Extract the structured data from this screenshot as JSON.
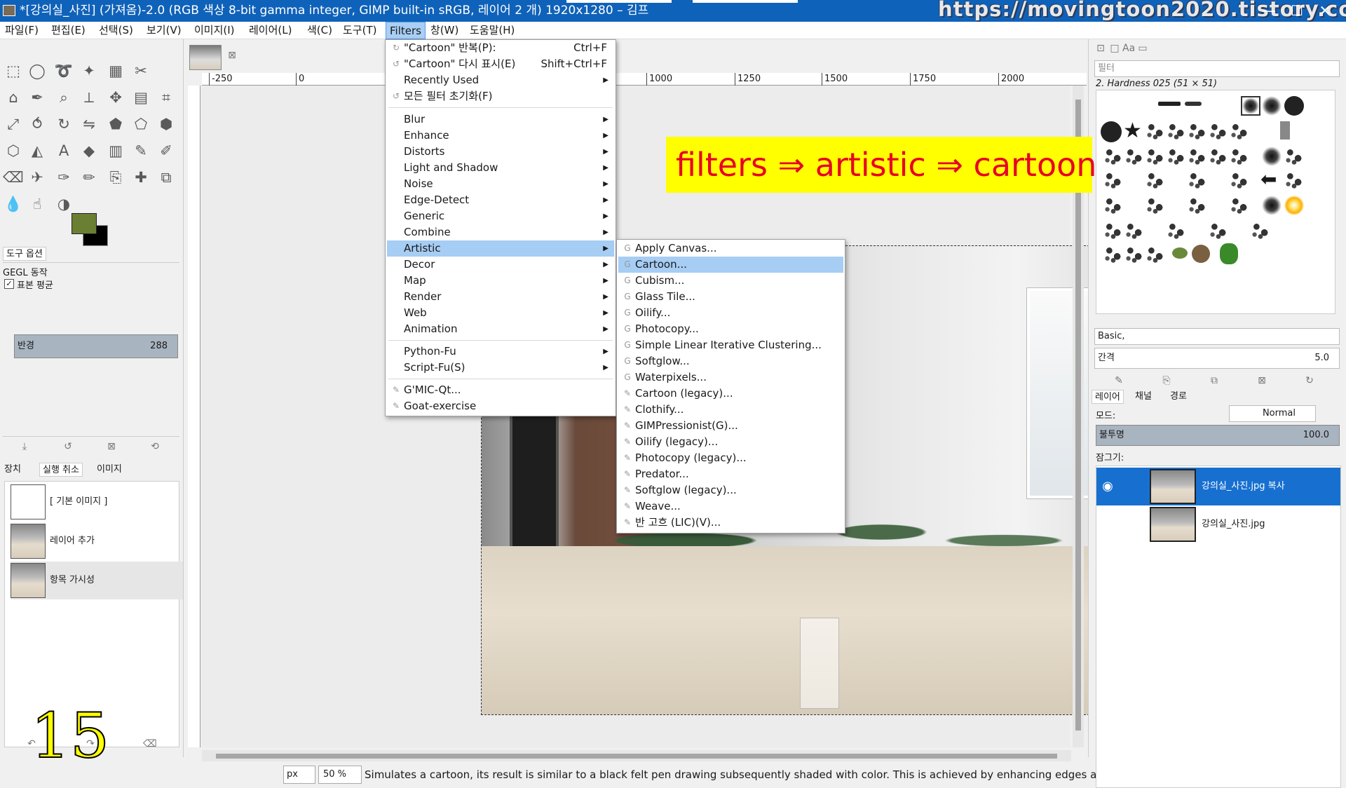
{
  "window": {
    "title": "*[강의실_사진] (가져옴)-2.0 (RGB 색상 8-bit gamma integer, GIMP built-in sRGB, 레이어 2 개) 1920x1280 – 김프",
    "watermark": "https://movingtoon2020.tistory.com",
    "minimize": "—",
    "maximize": "☐",
    "close": "✕"
  },
  "menubar": [
    "파일(F)",
    "편집(E)",
    "선택(S)",
    "보기(V)",
    "이미지(I)",
    "레이어(L)",
    "색(C)",
    "도구(T)",
    "Filters",
    "창(W)",
    "도움말(H)"
  ],
  "filters_menu": {
    "items": [
      {
        "label": "\"Cartoon\" 반복(P):",
        "shortcut": "Ctrl+F"
      },
      {
        "label": "\"Cartoon\" 다시 표시(E)",
        "shortcut": "Shift+Ctrl+F"
      },
      {
        "label": "Recently Used",
        "submenu": true
      },
      {
        "label": "모든 필터 초기화(F)"
      },
      {
        "label": "Blur",
        "submenu": true
      },
      {
        "label": "Enhance",
        "submenu": true
      },
      {
        "label": "Distorts",
        "submenu": true
      },
      {
        "label": "Light and Shadow",
        "submenu": true
      },
      {
        "label": "Noise",
        "submenu": true
      },
      {
        "label": "Edge-Detect",
        "submenu": true
      },
      {
        "label": "Generic",
        "submenu": true
      },
      {
        "label": "Combine",
        "submenu": true
      },
      {
        "label": "Artistic",
        "submenu": true,
        "highlighted": true
      },
      {
        "label": "Decor",
        "submenu": true
      },
      {
        "label": "Map",
        "submenu": true
      },
      {
        "label": "Render",
        "submenu": true
      },
      {
        "label": "Web",
        "submenu": true
      },
      {
        "label": "Animation",
        "submenu": true
      },
      {
        "label": "Python-Fu",
        "submenu": true
      },
      {
        "label": "Script-Fu(S)",
        "submenu": true
      },
      {
        "label": "G'MIC-Qt..."
      },
      {
        "label": "Goat-exercise"
      }
    ]
  },
  "artistic_menu": {
    "items": [
      "Apply Canvas...",
      "Cartoon...",
      "Cubism...",
      "Glass Tile...",
      "Oilify...",
      "Photocopy...",
      "Simple Linear Iterative Clustering...",
      "Softglow...",
      "Waterpixels...",
      "Cartoon (legacy)...",
      "Clothify...",
      "GIMPressionist(G)...",
      "Oilify (legacy)...",
      "Photocopy (legacy)...",
      "Predator...",
      "Softglow (legacy)...",
      "Weave...",
      "반 고흐 (LIC)(V)..."
    ],
    "highlighted": "Cartoon..."
  },
  "callout": "filters ⇒ artistic  ⇒ cartoon",
  "tool_options": {
    "tab": "도구 옵션",
    "heading": "GEGL 동작",
    "checkbox_label": "표본 평균",
    "slider_label": "반경",
    "slider_value": "288"
  },
  "history": {
    "tabs": [
      "장치",
      "실행 취소",
      "이미지"
    ],
    "items": [
      "[ 기본 이미지 ]",
      "레이어 추가",
      "항목 가시성"
    ]
  },
  "step_number": "15",
  "ruler": {
    "ticks": [
      "-250",
      "0",
      "1000",
      "1250",
      "1500",
      "1750",
      "2000"
    ]
  },
  "status": {
    "unit": "px",
    "zoom": "50 %",
    "message": "Simulates a cartoon, its result is similar to a black felt pen drawing subsequently shaded with color. This is achieved by enhancing edges a..."
  },
  "brushes": {
    "filter_placeholder": "필터",
    "current_brush": "2. Hardness 025 (51 × 51)",
    "preset": "Basic,",
    "spacing_label": "간격",
    "spacing_value": "5.0"
  },
  "layers": {
    "tabs": [
      "레이어",
      "채널",
      "경로"
    ],
    "mode_label": "모드:",
    "mode_value": "Normal",
    "opacity_label": "불투명",
    "opacity_value": "100.0",
    "lock_label": "잠그기:",
    "items": [
      {
        "name": "강의실_사진.jpg 복사",
        "selected": true,
        "visible": true
      },
      {
        "name": "강의실_사진.jpg",
        "selected": false,
        "visible": false
      }
    ]
  },
  "colors": {
    "titlebar": "#0f62b9",
    "highlight": "#a6cdf4",
    "layer_selected": "#1770d0",
    "callout_bg": "#ffff00",
    "callout_text": "#e8002a",
    "foreground": "#6b7f33",
    "background": "#000000"
  }
}
